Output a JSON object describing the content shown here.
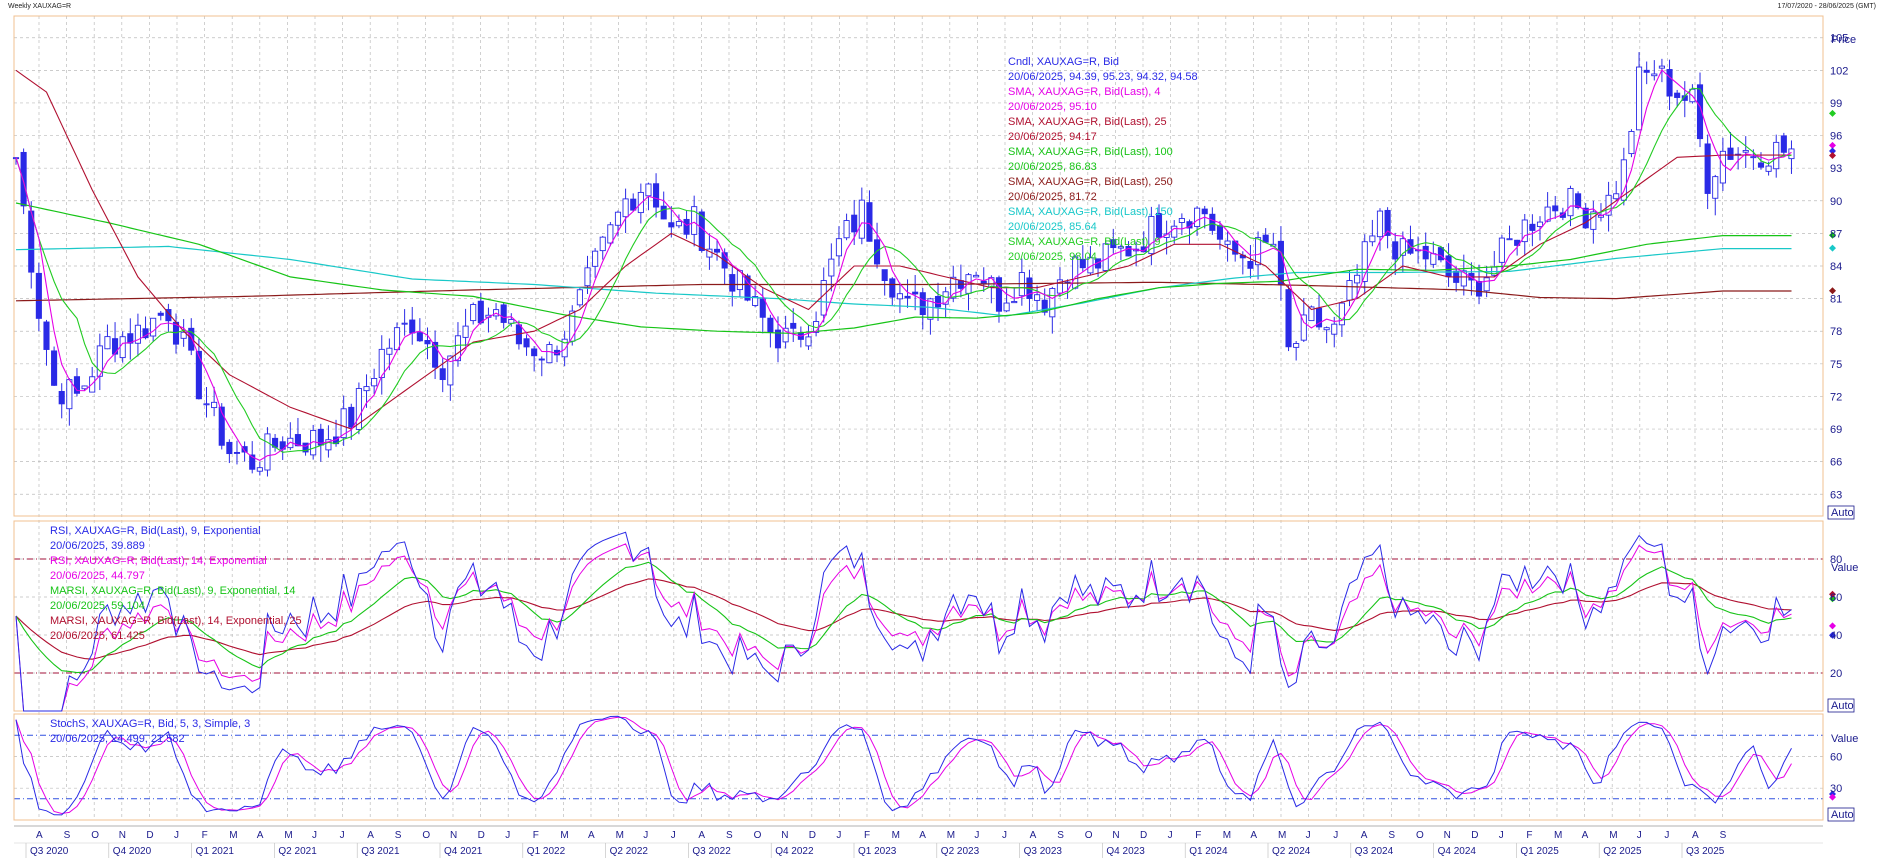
{
  "window": {
    "title": "Weekly XAUXAG=R",
    "date_range": "17/07/2020 - 28/06/2025 (GMT)"
  },
  "colors": {
    "candle": "#2a2ae6",
    "sma4": "#e600e6",
    "sma25": "#b01030",
    "sma100": "#17c417",
    "sma250": "#8b1a1a",
    "sma150": "#19c8c8",
    "sma9": "#22cc22",
    "grid": "#bcbcbc",
    "panel_border": "#f0c090",
    "axis_text": "#1a1a8c"
  },
  "price_panel": {
    "legend": [
      {
        "title": "Cndl, XAUXAG=R, Bid",
        "value": "20/06/2025, 94.39, 95.23, 94.32, 94.58",
        "color": "#2a2ae6"
      },
      {
        "title": "SMA, XAUXAG=R, Bid(Last),  4",
        "value": "20/06/2025, 95.10",
        "color": "#e600e6"
      },
      {
        "title": "SMA, XAUXAG=R, Bid(Last),  25",
        "value": "20/06/2025, 94.17",
        "color": "#b01030"
      },
      {
        "title": "SMA, XAUXAG=R, Bid(Last),  100",
        "value": "20/06/2025, 86.83",
        "color": "#17c417"
      },
      {
        "title": "SMA, XAUXAG=R, Bid(Last),  250",
        "value": "20/06/2025, 81.72",
        "color": "#8b1a1a"
      },
      {
        "title": "SMA, XAUXAG=R, Bid(Last),  150",
        "value": "20/06/2025, 85.64",
        "color": "#19c8c8"
      },
      {
        "title": "SMA, XAUXAG=R, Bid(Last),  9",
        "value": "20/06/2025, 98.04",
        "color": "#22cc22"
      }
    ],
    "axis_title": "Price",
    "auto_label": "Auto"
  },
  "rsi_panel": {
    "legend": [
      {
        "title": "RSI, XAUXAG=R, Bid(Last),  9, Exponential",
        "value": "20/06/2025, 39.889",
        "color": "#2a2ae6"
      },
      {
        "title": "RSI, XAUXAG=R, Bid(Last),  14, Exponential",
        "value": "20/06/2025, 44.797",
        "color": "#e600e6"
      },
      {
        "title": "MARSI, XAUXAG=R, Bid(Last),  9, Exponential, 14",
        "value": "20/06/2025, 59.104",
        "color": "#17c417"
      },
      {
        "title": "MARSI, XAUXAG=R, Bid(Last),  14, Exponential, 25",
        "value": "20/06/2025, 61.425",
        "color": "#b01030"
      }
    ],
    "axis_title": "Value",
    "auto_label": "Auto"
  },
  "stoch_panel": {
    "legend": [
      {
        "title": "StochS, XAUXAG=R, Bid,  5, 3, Simple, 3",
        "value": "20/06/2025, 24.499, 21.582",
        "color": "#2a2ae6"
      }
    ],
    "axis_title": "Value",
    "auto_label": "Auto"
  },
  "chart_data": {
    "type": "candlestick",
    "instrument": "XAUXAG=R",
    "interval": "Weekly",
    "price_axis": {
      "ticks": [
        63,
        66,
        69,
        72,
        75,
        78,
        81,
        84,
        87,
        90,
        93,
        96,
        99,
        102,
        105
      ],
      "ylim": [
        61,
        107
      ]
    },
    "rsi_axis": {
      "ticks": [
        20,
        40,
        60,
        80
      ],
      "ylim": [
        0,
        100
      ],
      "bands": [
        20,
        80
      ]
    },
    "stoch_axis": {
      "ticks": [
        30,
        60
      ],
      "ylim": [
        0,
        100
      ],
      "bands": [
        20,
        80
      ]
    },
    "x_month_labels": [
      "A",
      "S",
      "O",
      "N",
      "D",
      "J",
      "F",
      "M",
      "A",
      "M",
      "J",
      "J",
      "A",
      "S",
      "O",
      "N",
      "D",
      "J",
      "F",
      "M",
      "A",
      "M",
      "J",
      "J",
      "A",
      "S",
      "O",
      "N",
      "D",
      "J",
      "F",
      "M",
      "A",
      "M",
      "J",
      "J",
      "A",
      "S",
      "O",
      "N",
      "D",
      "J",
      "F",
      "M",
      "A",
      "M",
      "J",
      "J",
      "A",
      "S",
      "O",
      "N",
      "D",
      "J",
      "F",
      "M",
      "A",
      "M",
      "J",
      "J",
      "A",
      "S"
    ],
    "x_quarter_labels": [
      "Q3 2020",
      "Q4 2020",
      "Q1 2021",
      "Q2 2021",
      "Q3 2021",
      "Q4 2021",
      "Q1 2022",
      "Q2 2022",
      "Q3 2022",
      "Q4 2022",
      "Q1 2023",
      "Q2 2023",
      "Q3 2023",
      "Q4 2023",
      "Q1 2024",
      "Q2 2024",
      "Q3 2024",
      "Q4 2024",
      "Q1 2025",
      "Q2 2025",
      "Q3 2025"
    ],
    "close_keypoints": [
      [
        0,
        94
      ],
      [
        3,
        80
      ],
      [
        5,
        73
      ],
      [
        8,
        72
      ],
      [
        12,
        77
      ],
      [
        16,
        78
      ],
      [
        20,
        80
      ],
      [
        24,
        73
      ],
      [
        28,
        67
      ],
      [
        31,
        66
      ],
      [
        35,
        68
      ],
      [
        40,
        68
      ],
      [
        44,
        70
      ],
      [
        48,
        76
      ],
      [
        52,
        79
      ],
      [
        56,
        75
      ],
      [
        60,
        79
      ],
      [
        63,
        80
      ],
      [
        66,
        77
      ],
      [
        70,
        76
      ],
      [
        73,
        79
      ],
      [
        76,
        84
      ],
      [
        80,
        90
      ],
      [
        83,
        92
      ],
      [
        86,
        87
      ],
      [
        89,
        88
      ],
      [
        93,
        84
      ],
      [
        96,
        81
      ],
      [
        99,
        78
      ],
      [
        102,
        77
      ],
      [
        105,
        80
      ],
      [
        108,
        86
      ],
      [
        111,
        89
      ],
      [
        114,
        84
      ],
      [
        117,
        80
      ],
      [
        120,
        81
      ],
      [
        123,
        83
      ],
      [
        126,
        84
      ],
      [
        129,
        81
      ],
      [
        132,
        83
      ],
      [
        135,
        81
      ],
      [
        138,
        84
      ],
      [
        141,
        84
      ],
      [
        144,
        85
      ],
      [
        147,
        86
      ],
      [
        150,
        88
      ],
      [
        153,
        89
      ],
      [
        156,
        89
      ],
      [
        159,
        85
      ],
      [
        162,
        85
      ],
      [
        165,
        86
      ],
      [
        167,
        76
      ],
      [
        170,
        79
      ],
      [
        173,
        78
      ],
      [
        176,
        83
      ],
      [
        179,
        88
      ],
      [
        182,
        85
      ],
      [
        185,
        85
      ],
      [
        188,
        83
      ],
      [
        191,
        82
      ],
      [
        194,
        84
      ],
      [
        197,
        87
      ],
      [
        200,
        89
      ],
      [
        203,
        90
      ],
      [
        206,
        89
      ],
      [
        209,
        90
      ],
      [
        211,
        93
      ],
      [
        213,
        101
      ],
      [
        215,
        102
      ],
      [
        218,
        100
      ],
      [
        220,
        99
      ],
      [
        222,
        92
      ],
      [
        224,
        94.6
      ]
    ],
    "sma25_keypoints": [
      [
        0,
        102
      ],
      [
        4,
        100
      ],
      [
        10,
        91
      ],
      [
        16,
        83
      ],
      [
        22,
        78
      ],
      [
        28,
        74
      ],
      [
        36,
        71
      ],
      [
        44,
        69
      ],
      [
        52,
        73
      ],
      [
        60,
        77
      ],
      [
        68,
        78
      ],
      [
        74,
        80
      ],
      [
        80,
        84
      ],
      [
        86,
        87
      ],
      [
        92,
        85
      ],
      [
        98,
        82
      ],
      [
        104,
        80
      ],
      [
        110,
        84
      ],
      [
        116,
        84
      ],
      [
        122,
        83
      ],
      [
        128,
        82
      ],
      [
        134,
        82
      ],
      [
        140,
        83
      ],
      [
        146,
        84
      ],
      [
        152,
        86
      ],
      [
        158,
        86
      ],
      [
        164,
        84
      ],
      [
        170,
        80
      ],
      [
        176,
        81
      ],
      [
        182,
        84
      ],
      [
        188,
        83
      ],
      [
        194,
        83
      ],
      [
        200,
        86
      ],
      [
        206,
        88
      ],
      [
        212,
        91
      ],
      [
        218,
        94
      ],
      [
        224,
        94.2
      ]
    ],
    "sma100_keypoints": [
      [
        0,
        89.8
      ],
      [
        12,
        88
      ],
      [
        24,
        86
      ],
      [
        36,
        83
      ],
      [
        48,
        81.8
      ],
      [
        60,
        81.2
      ],
      [
        72,
        79.5
      ],
      [
        82,
        78.4
      ],
      [
        92,
        78
      ],
      [
        102,
        77.8
      ],
      [
        110,
        78.3
      ],
      [
        118,
        79.3
      ],
      [
        126,
        79.2
      ],
      [
        134,
        79.7
      ],
      [
        142,
        81
      ],
      [
        150,
        82
      ],
      [
        158,
        82.4
      ],
      [
        166,
        82.6
      ],
      [
        176,
        83.7
      ],
      [
        186,
        83.6
      ],
      [
        196,
        84
      ],
      [
        204,
        84.6
      ],
      [
        214,
        86
      ],
      [
        224,
        86.8
      ]
    ],
    "sma150_keypoints": [
      [
        0,
        85.5
      ],
      [
        20,
        85.8
      ],
      [
        36,
        84.6
      ],
      [
        52,
        82.8
      ],
      [
        68,
        82.3
      ],
      [
        84,
        81.5
      ],
      [
        100,
        81
      ],
      [
        110,
        80.5
      ],
      [
        120,
        80.2
      ],
      [
        130,
        79.4
      ],
      [
        140,
        80.6
      ],
      [
        150,
        82
      ],
      [
        160,
        82.9
      ],
      [
        168,
        83.4
      ],
      [
        180,
        83.4
      ],
      [
        196,
        83.5
      ],
      [
        210,
        84.7
      ],
      [
        224,
        85.6
      ]
    ],
    "sma250_keypoints": [
      [
        0,
        80.8
      ],
      [
        30,
        81.2
      ],
      [
        60,
        81.8
      ],
      [
        90,
        82.3
      ],
      [
        120,
        82.3
      ],
      [
        150,
        82.5
      ],
      [
        170,
        82.2
      ],
      [
        190,
        81.8
      ],
      [
        200,
        81.1
      ],
      [
        210,
        81
      ],
      [
        218,
        81.4
      ],
      [
        224,
        81.7
      ]
    ],
    "last_values": {
      "close": 94.58,
      "sma4": 95.1,
      "sma25": 94.17,
      "sma100": 86.83,
      "sma250": 81.72,
      "sma150": 85.64,
      "sma9": 98.04,
      "rsi9": 39.889,
      "rsi14": 44.797,
      "marsi9": 59.104,
      "marsi14": 61.425,
      "stoch_k": 24.499,
      "stoch_d": 21.582
    }
  }
}
